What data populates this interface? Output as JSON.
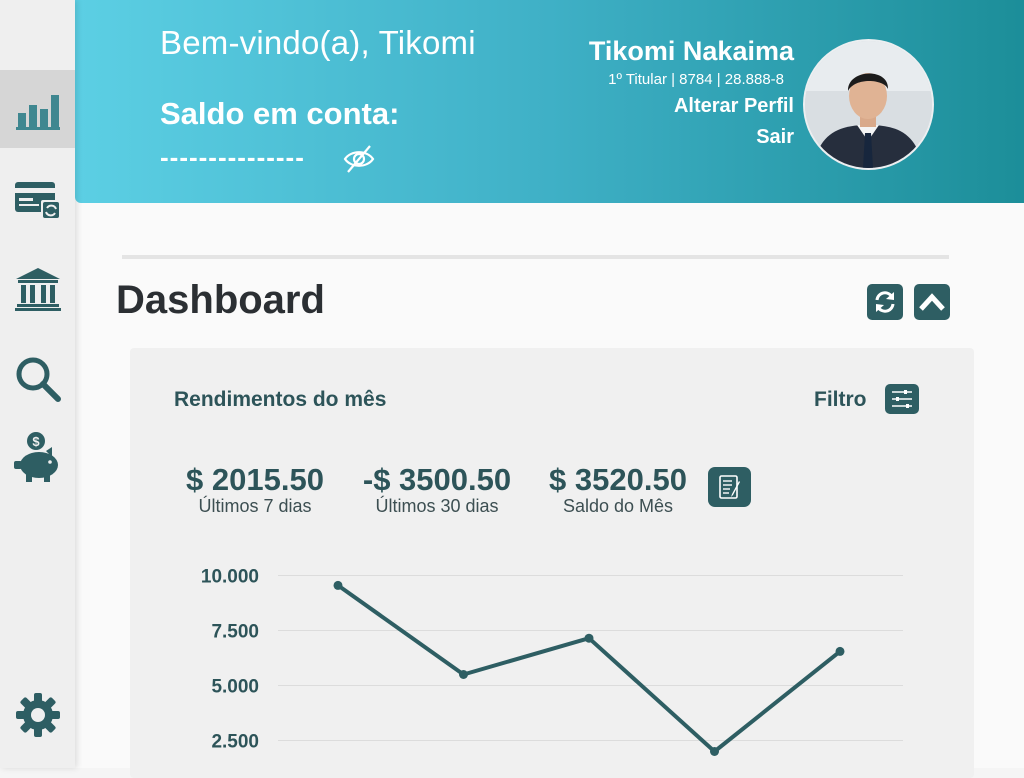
{
  "sidebar": {
    "items": [
      {
        "icon": "bar-chart-icon"
      },
      {
        "icon": "card-refresh-icon"
      },
      {
        "icon": "bank-icon"
      },
      {
        "icon": "search-icon"
      },
      {
        "icon": "piggy-bank-icon"
      }
    ],
    "settings_icon": "gear-icon"
  },
  "header": {
    "welcome": "Bem-vindo(a), Tikomi",
    "balance_label": "Saldo em conta:",
    "balance_hidden": "---------------",
    "user_name": "Tikomi Nakaima",
    "user_info": "1º Titular | 8784 | 28.888-8",
    "change_profile": "Alterar Perfil",
    "logout": "Sair"
  },
  "dashboard": {
    "title": "Dashboard",
    "card": {
      "title": "Rendimentos do mês",
      "filter_label": "Filtro",
      "stats": [
        {
          "value": "$ 2015.50",
          "label": "Últimos 7 dias"
        },
        {
          "value": "-$ 3500.50",
          "label": "Últimos 30 dias"
        },
        {
          "value": "$ 3520.50",
          "label": "Saldo do Mês"
        }
      ]
    }
  },
  "colors": {
    "accent": "#2e5e63",
    "header_start": "#5ccfe4",
    "header_end": "#1c8e99"
  },
  "chart_data": {
    "type": "line",
    "title": "",
    "xlabel": "",
    "ylabel": "",
    "y_ticks": [
      "10.000",
      "7.500",
      "5.000",
      "2.500"
    ],
    "ylim": [
      0,
      10000
    ],
    "x": [
      1,
      2,
      3,
      4,
      5
    ],
    "series": [
      {
        "values": [
          9550,
          5500,
          7150,
          2000,
          6550
        ]
      }
    ],
    "grid": true
  }
}
